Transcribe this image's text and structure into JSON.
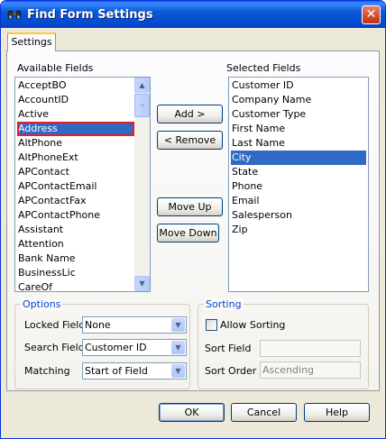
{
  "window": {
    "title": "Find Form Settings",
    "close_symbol": "✕"
  },
  "tabs": [
    {
      "label": "Settings"
    }
  ],
  "available": {
    "label": "Available Fields",
    "items": [
      "AcceptBO",
      "AccountID",
      "Active",
      "Address",
      "AltPhone",
      "AltPhoneExt",
      "APContact",
      "APContactEmail",
      "APContactFax",
      "APContactPhone",
      "Assistant",
      "Attention",
      "Bank Name",
      "BusinessLic",
      "CareOf"
    ],
    "selected_index": 3
  },
  "selected": {
    "label": "Selected Fields",
    "items": [
      "Customer ID",
      "Company Name",
      "Customer Type",
      "First Name",
      "Last Name",
      "City",
      "State",
      "Phone",
      "Email",
      "Salesperson",
      "Zip"
    ],
    "selected_index": 5
  },
  "buttons": {
    "add": "Add >",
    "remove": "< Remove",
    "move_up": "Move Up",
    "move_down": "Move Down",
    "ok": "OK",
    "cancel": "Cancel",
    "help": "Help"
  },
  "options": {
    "title": "Options",
    "locked_field": {
      "label": "Locked Field",
      "value": "None"
    },
    "search_field": {
      "label": "Search Field",
      "value": "Customer ID"
    },
    "matching": {
      "label": "Matching",
      "value": "Start of Field"
    }
  },
  "sorting": {
    "title": "Sorting",
    "allow_sorting": {
      "label": "Allow Sorting",
      "checked": false
    },
    "sort_field": {
      "label": "Sort Field",
      "value": ""
    },
    "sort_order": {
      "label": "Sort Order",
      "value": "Ascending"
    }
  },
  "icons": {
    "title_icon": "binoculars-icon",
    "scroll_up": "▲",
    "scroll_down": "▼",
    "combo_arrow": "▼",
    "thumb_grip": "≡"
  },
  "colors": {
    "selection": "#316ac5",
    "focus_outline": "#e0202a",
    "titlebar": "#0a58d8",
    "group_title": "#0046d5"
  }
}
